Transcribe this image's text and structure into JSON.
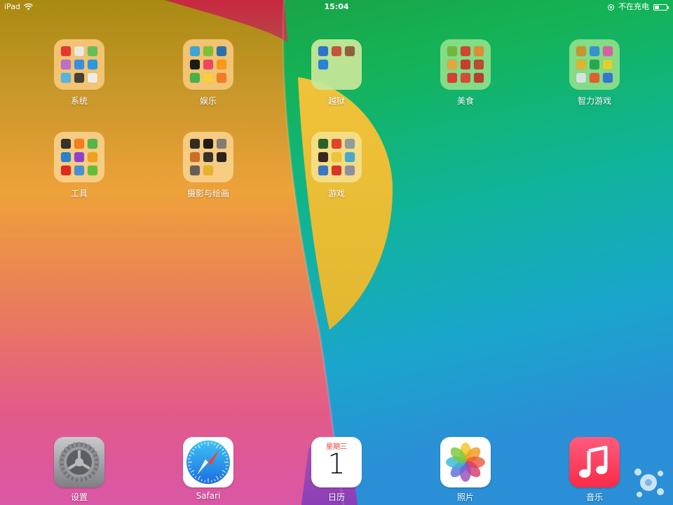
{
  "status_bar": {
    "device": "iPad",
    "time": "15:04",
    "charging_status": "不在充电",
    "battery_level": 0.35
  },
  "folders": [
    {
      "label": "系统",
      "tint": "#f7c87a",
      "icons": [
        "#e8312f",
        "#f0f0f0",
        "#5fc35b",
        "#b86ed6",
        "#2f8ef0",
        "#1f9af2",
        "#4db7f0",
        "#3a3a3a",
        "#f4f4f4"
      ]
    },
    {
      "label": "娱乐",
      "tint": "#f7c87a",
      "icons": [
        "#2ea8e8",
        "#7cc33b",
        "#1d6fb8",
        "#111111",
        "#ee4466",
        "#ff9a1a",
        "#3bb54a",
        "#ffd33d",
        "#f57c20"
      ]
    },
    {
      "label": "越狱",
      "tint": "#c9e99a",
      "icons": [
        "#2f6fd8",
        "#d84a3a",
        "#9a5a3a",
        "#2a7fe0"
      ]
    },
    {
      "label": "美食",
      "tint": "#8ee08a",
      "icons": [
        "#7ab83a",
        "#e23c2d",
        "#f08b2a",
        "#f6a63a",
        "#d8342c",
        "#c8432a",
        "#e8342e",
        "#e6432f",
        "#c8362a"
      ]
    },
    {
      "label": "智力游戏",
      "tint": "#8ee08a",
      "icons": [
        "#d8922a",
        "#3a8fd8",
        "#e85aa8",
        "#f0b42a",
        "#2aa84a",
        "#f0d42a",
        "#e8e8e8",
        "#f05a2a",
        "#3a6fd8"
      ]
    },
    {
      "label": "工具",
      "tint": "#f9d08a",
      "icons": [
        "#2a2a2a",
        "#f57c1a",
        "#4ab84a",
        "#1a7fd8",
        "#8a3ad8",
        "#f0a21a",
        "#e0201a",
        "#3a8fe0",
        "#5ac03a"
      ]
    },
    {
      "label": "摄影与绘画",
      "tint": "#f9d08a",
      "icons": [
        "#222222",
        "#111111",
        "#7a7a7a",
        "#c86a2a",
        "#2a2a2a",
        "#1a1a1a",
        "#5a5a5a",
        "#e8b42a"
      ]
    },
    {
      "label": "游戏",
      "tint": "#f5e08a",
      "icons": [
        "#1a5a2a",
        "#e03a2a",
        "#8a9aa8",
        "#2a1a1a",
        "#f0c43a",
        "#3aa8d8",
        "#2a6fd8",
        "#d82a2a",
        "#8a8aa8"
      ]
    }
  ],
  "dock": {
    "settings": {
      "label": "设置",
      "icon": "settings-gear-icon"
    },
    "safari": {
      "label": "Safari",
      "icon": "safari-compass-icon"
    },
    "calendar": {
      "label": "日历",
      "weekday": "星期三",
      "day": "1",
      "icon": "calendar-icon"
    },
    "photos": {
      "label": "照片",
      "icon": "photos-flower-icon"
    },
    "music": {
      "label": "音乐",
      "icon": "music-note-icon"
    }
  }
}
